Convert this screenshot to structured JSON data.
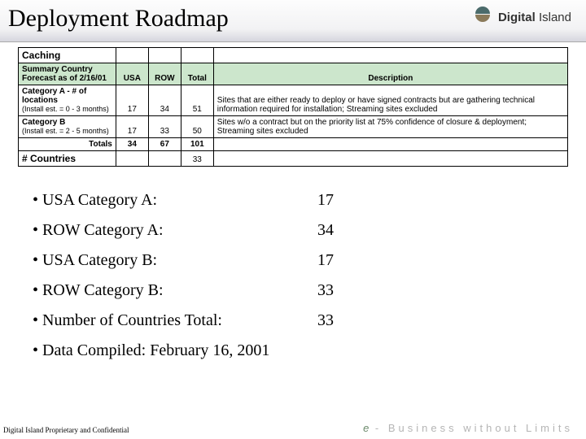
{
  "header": {
    "title": "Deployment Roadmap",
    "brand_bold": "Digital",
    "brand_rest": " Island"
  },
  "table": {
    "caching": "Caching",
    "summary": "Summary Country Forecast as of 2/16/01",
    "col_usa": "USA",
    "col_row": "ROW",
    "col_total": "Total",
    "col_desc": "Description",
    "catA_label": "Category A  - # of locations",
    "catA_install": "(Install est. = 0 - 3 months)",
    "catA_usa": "17",
    "catA_row": "34",
    "catA_total": "51",
    "catA_desc": "Sites that are either ready to deploy or have signed contracts but are gathering technical information required for installation; Streaming sites excluded",
    "catB_label": "Category B",
    "catB_install": "(Install est. = 2 - 5 months)",
    "catB_usa": "17",
    "catB_row": "33",
    "catB_total": "50",
    "catB_desc": "Sites w/o a contract but on the priority list at 75% confidence of closure & deployment; Streaming sites excluded",
    "totals_label": "Totals",
    "tot_usa": "34",
    "tot_row": "67",
    "tot_total": "101",
    "countries_label": "# Countries",
    "countries_total": "33"
  },
  "bullets": {
    "b1_label": "• USA Category A:",
    "b1_val": "17",
    "b2_label": "• ROW Category A:",
    "b2_val": "34",
    "b3_label": "• USA Category B:",
    "b3_val": "17",
    "b4_label": "• ROW Category B:",
    "b4_val": "33",
    "b5_label": "• Number of Countries Total:",
    "b5_val": "33",
    "b6_label": "• Data Compiled:  February 16, 2001"
  },
  "footer": {
    "confidential": "Digital Island Proprietary and Confidential",
    "tag_e": "e",
    "tag_dash": " - ",
    "tag_rest": "Business without Limits"
  },
  "chart_data": {
    "type": "table",
    "title": "Caching — Summary Country Forecast as of 2/16/01",
    "columns": [
      "Category",
      "USA",
      "ROW",
      "Total",
      "Description"
    ],
    "rows": [
      {
        "Category": "Category A - # of locations (Install est. = 0 - 3 months)",
        "USA": 17,
        "ROW": 34,
        "Total": 51,
        "Description": "Sites that are either ready to deploy or have signed contracts but are gathering technical information required for installation; Streaming sites excluded"
      },
      {
        "Category": "Category B (Install est. = 2 - 5 months)",
        "USA": 17,
        "ROW": 33,
        "Total": 50,
        "Description": "Sites w/o a contract but on the priority list at 75% confidence of closure & deployment; Streaming sites excluded"
      },
      {
        "Category": "Totals",
        "USA": 34,
        "ROW": 67,
        "Total": 101,
        "Description": ""
      },
      {
        "Category": "# Countries",
        "USA": null,
        "ROW": null,
        "Total": 33,
        "Description": ""
      }
    ]
  }
}
